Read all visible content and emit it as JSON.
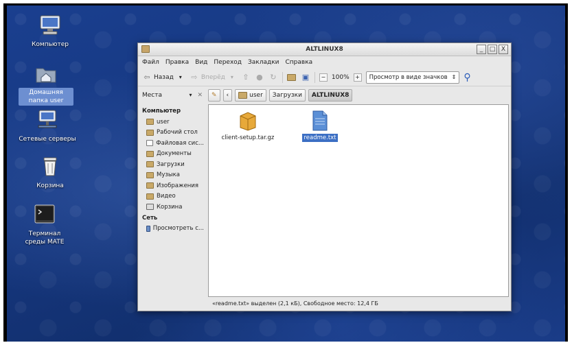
{
  "desktop_icons": [
    {
      "name": "computer",
      "label": "Компьютер"
    },
    {
      "name": "home",
      "label": "Домашняя папка user",
      "selected": true
    },
    {
      "name": "network",
      "label": "Сетевые серверы"
    },
    {
      "name": "trash",
      "label": "Корзина"
    },
    {
      "name": "terminal",
      "label": "Терминал среды MATE"
    }
  ],
  "window": {
    "title": "ALTLINUX8",
    "controls": {
      "minimize": "_",
      "maximize": "□",
      "close": "X"
    }
  },
  "menu": [
    "Файл",
    "Правка",
    "Вид",
    "Переход",
    "Закладки",
    "Справка"
  ],
  "toolbar": {
    "back_label": "Назад",
    "forward_label": "Вперёд",
    "zoom": "100%",
    "view_mode": "Просмотр в виде значков"
  },
  "location": {
    "places_label": "Места",
    "crumbs": [
      "user",
      "Загрузки",
      "ALTLINUX8"
    ]
  },
  "sidebar": {
    "computer_header": "Компьютер",
    "computer_items": [
      {
        "label": "user",
        "icon": "folder"
      },
      {
        "label": "Рабочий стол",
        "icon": "folder"
      },
      {
        "label": "Файловая сис...",
        "icon": "drive"
      },
      {
        "label": "Документы",
        "icon": "folder"
      },
      {
        "label": "Загрузки",
        "icon": "folder"
      },
      {
        "label": "Музыка",
        "icon": "folder"
      },
      {
        "label": "Изображения",
        "icon": "folder"
      },
      {
        "label": "Видео",
        "icon": "folder"
      },
      {
        "label": "Корзина",
        "icon": "trash"
      }
    ],
    "network_header": "Сеть",
    "network_items": [
      {
        "label": "Просмотреть с...",
        "icon": "net"
      }
    ]
  },
  "files": [
    {
      "name": "client-setup.tar.gz",
      "icon": "archive",
      "selected": false
    },
    {
      "name": "readme.txt",
      "icon": "text",
      "selected": true
    }
  ],
  "status": "«readme.txt» выделен (2,1 кБ), Свободное место: 12,4 ГБ"
}
